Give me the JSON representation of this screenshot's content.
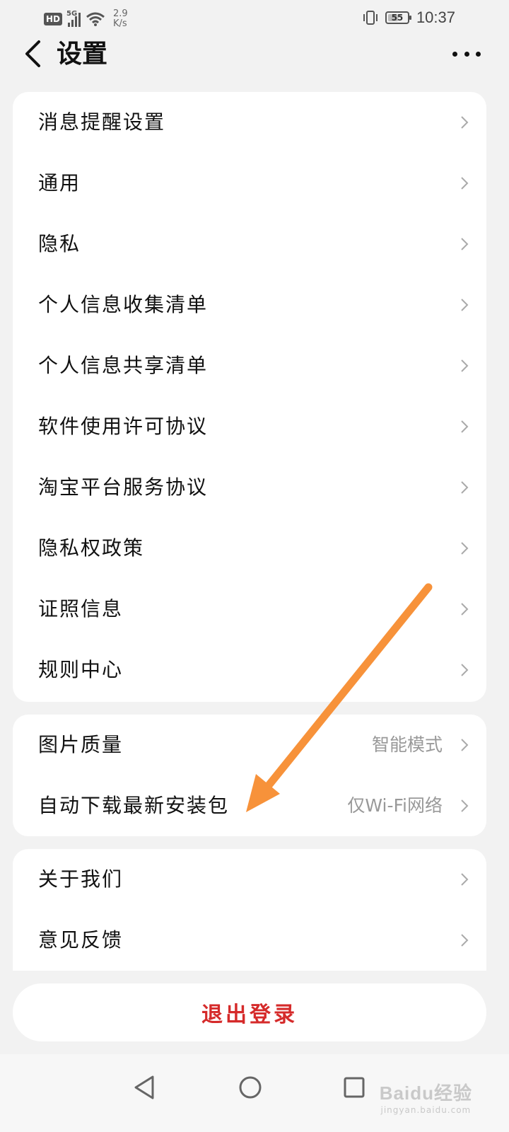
{
  "status_bar": {
    "hd": "HD",
    "network": "5G",
    "speed_value": "2.9",
    "speed_unit": "K/s",
    "battery": "55",
    "battery_level": 0.55,
    "time": "10:37"
  },
  "header": {
    "back_icon": "chevron-left-icon",
    "title": "设置",
    "more_icon": "more-horizontal-icon"
  },
  "groups": [
    {
      "items": [
        {
          "label": "消息提醒设置"
        },
        {
          "label": "通用"
        },
        {
          "label": "隐私"
        },
        {
          "label": "个人信息收集清单"
        },
        {
          "label": "个人信息共享清单"
        },
        {
          "label": "软件使用许可协议"
        },
        {
          "label": "淘宝平台服务协议"
        },
        {
          "label": "隐私权政策"
        },
        {
          "label": "证照信息"
        },
        {
          "label": "规则中心"
        }
      ]
    },
    {
      "items": [
        {
          "label": "图片质量",
          "value": "智能模式"
        },
        {
          "label": "自动下载最新安装包",
          "value": "仅Wi-Fi网络"
        }
      ]
    },
    {
      "items": [
        {
          "label": "关于我们"
        },
        {
          "label": "意见反馈"
        }
      ]
    }
  ],
  "logout_label": "退出登录",
  "annotation_color": "#f7923a",
  "accent_red": "#d52a2a",
  "nav": {
    "back_icon": "triangle-back-icon",
    "home_icon": "circle-home-icon",
    "recent_icon": "square-recent-icon"
  },
  "watermark": {
    "main": "Baidu经验",
    "sub": "jingyan.baidu.com"
  }
}
